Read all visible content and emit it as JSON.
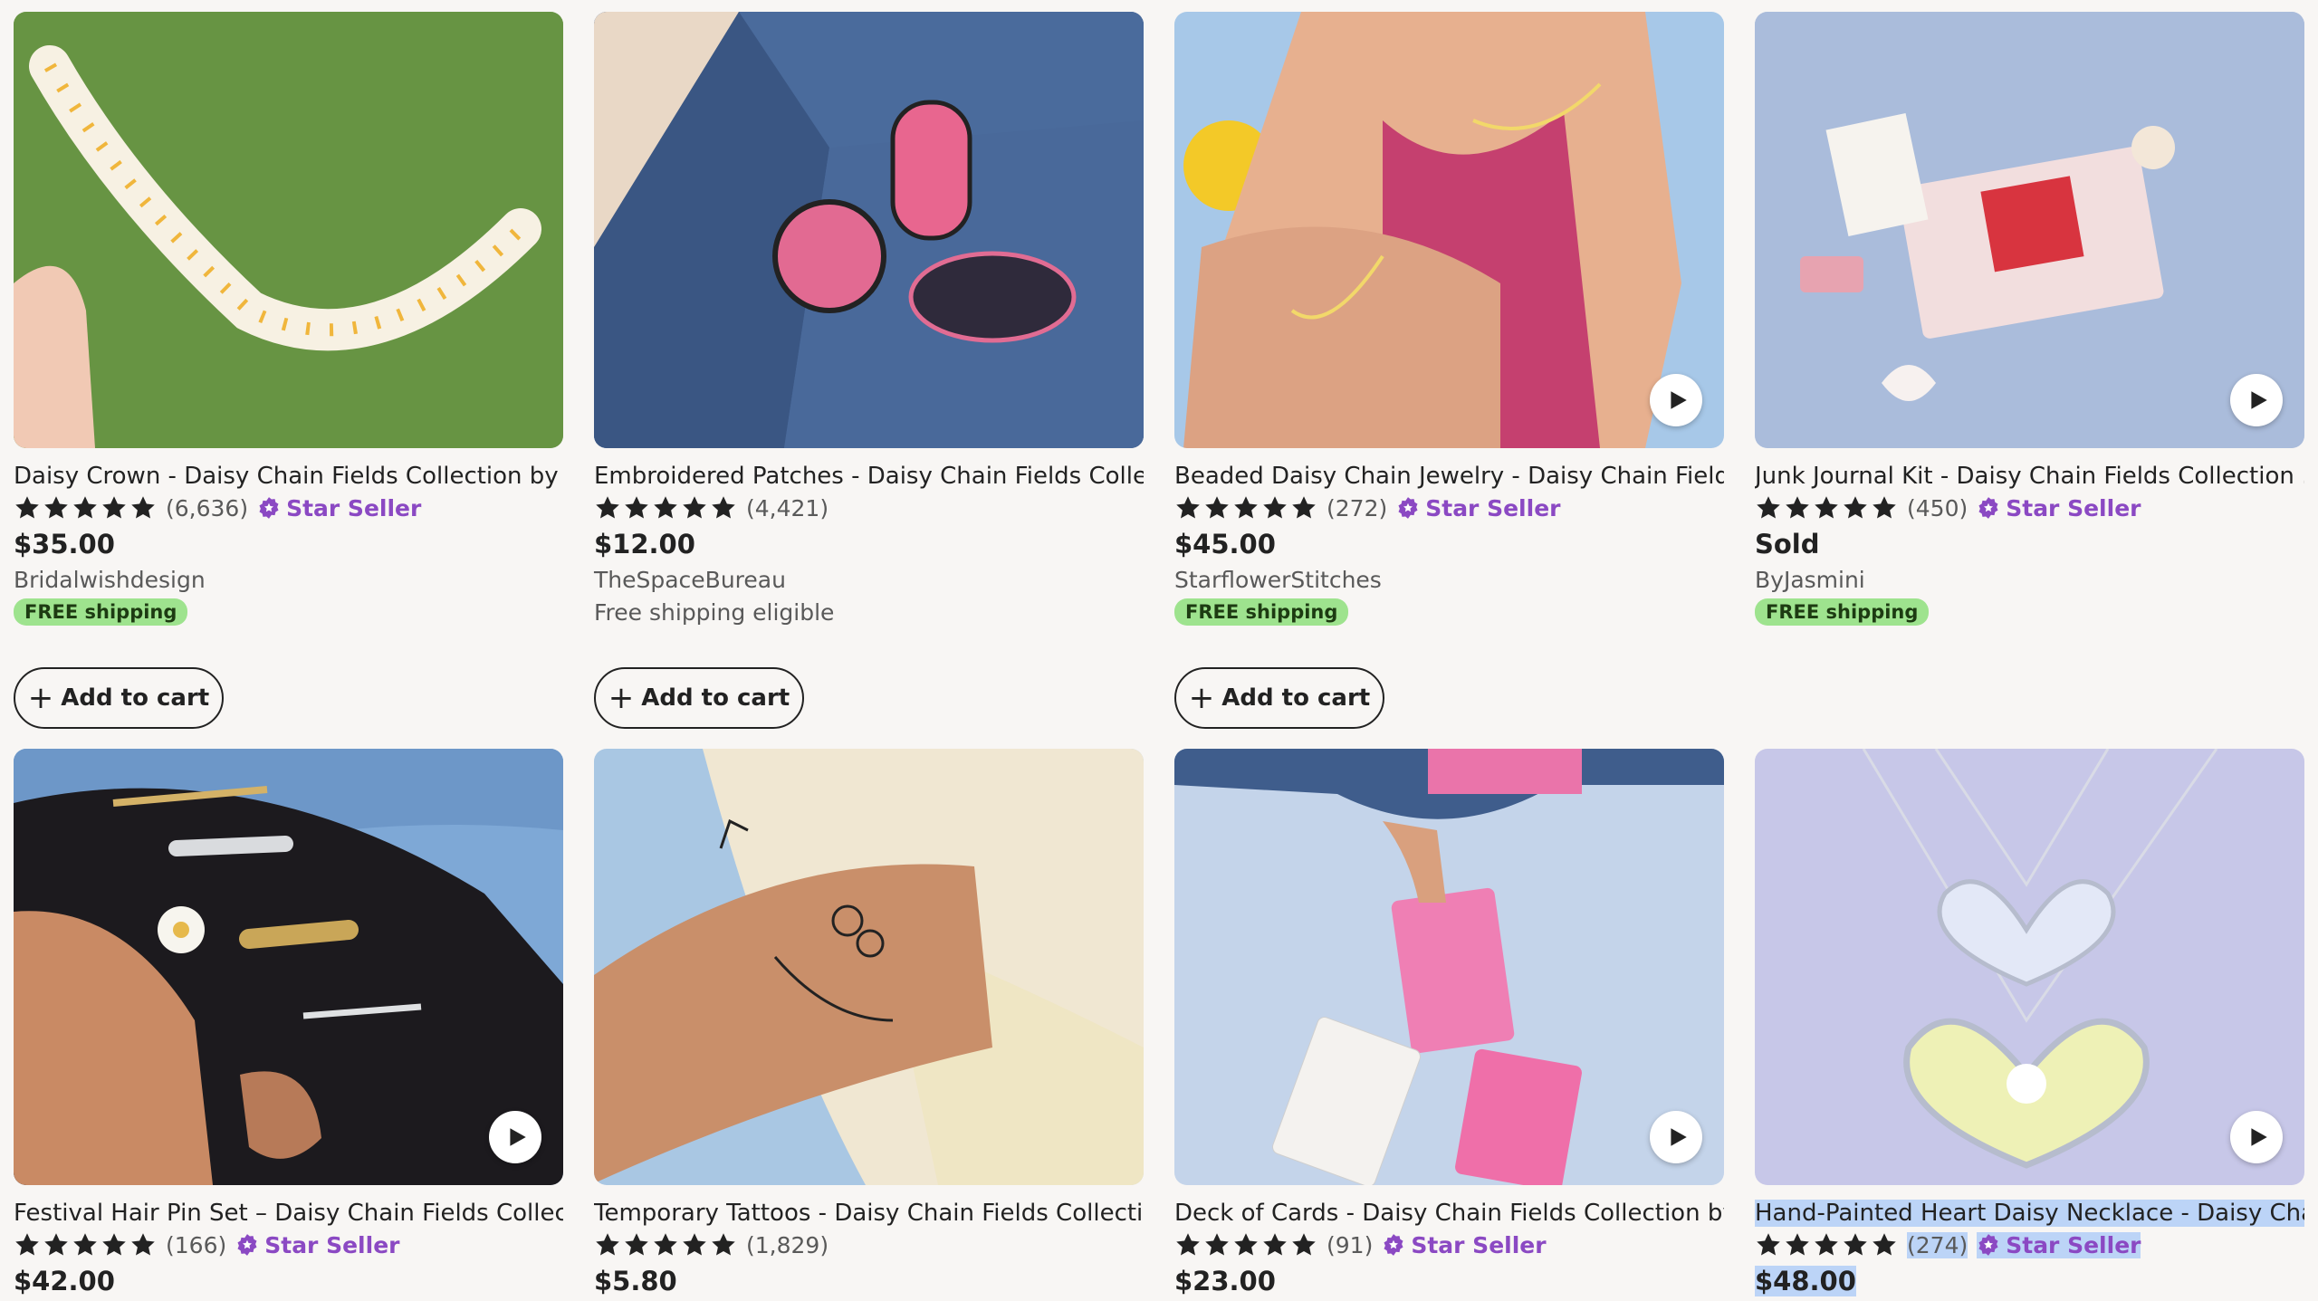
{
  "colors": {
    "star_seller": "#8b49c3",
    "free_pill": "#9ee38e",
    "selection": "#bcd4f7"
  },
  "icons": {
    "play": "play-icon",
    "star": "star-icon",
    "star_seller": "star-seller-badge-icon",
    "plus": "plus-icon"
  },
  "add_to_cart_label": "Add to cart",
  "star_seller_label": "Star Seller",
  "listings": [
    {
      "title": "Daisy Crown - Daisy Chain Fields Collection by ...",
      "count": "(6,636)",
      "star_seller": true,
      "price": "$35.00",
      "shop": "Bridalwishdesign",
      "shipping": "FREE shipping",
      "shipping_style": "pill",
      "has_video": false,
      "add_to_cart": true
    },
    {
      "title": "Embroidered Patches - Daisy Chain Fields Colle...",
      "count": "(4,421)",
      "star_seller": false,
      "price": "$12.00",
      "shop": "TheSpaceBureau",
      "shipping": "Free shipping eligible",
      "shipping_style": "text",
      "has_video": false,
      "add_to_cart": true
    },
    {
      "title": "Beaded Daisy Chain Jewelry - Daisy Chain Fields...",
      "count": "(272)",
      "star_seller": true,
      "price": "$45.00",
      "shop": "StarflowerStitches",
      "shipping": "FREE shipping",
      "shipping_style": "pill",
      "has_video": true,
      "add_to_cart": true
    },
    {
      "title": "Junk Journal Kit - Daisy Chain Fields Collection ...",
      "count": "(450)",
      "star_seller": true,
      "price": "Sold",
      "shop": "ByJasmini",
      "shipping": "FREE shipping",
      "shipping_style": "pill",
      "has_video": true,
      "add_to_cart": false
    },
    {
      "title": "Festival Hair Pin Set – Daisy Chain Fields Collect...",
      "count": "(166)",
      "star_seller": true,
      "price": "$42.00",
      "has_video": true
    },
    {
      "title": "Temporary Tattoos - Daisy Chain Fields Collectio...",
      "count": "(1,829)",
      "star_seller": false,
      "price": "$5.80",
      "has_video": false
    },
    {
      "title": "Deck of Cards - Daisy Chain Fields Collection by ...",
      "count": "(91)",
      "star_seller": true,
      "price": "$23.00",
      "has_video": true
    },
    {
      "title": "Hand-Painted Heart Daisy Necklace - Daisy Chai...",
      "count": "(274)",
      "star_seller": true,
      "price": "$48.00",
      "has_video": true,
      "selected": true
    }
  ]
}
